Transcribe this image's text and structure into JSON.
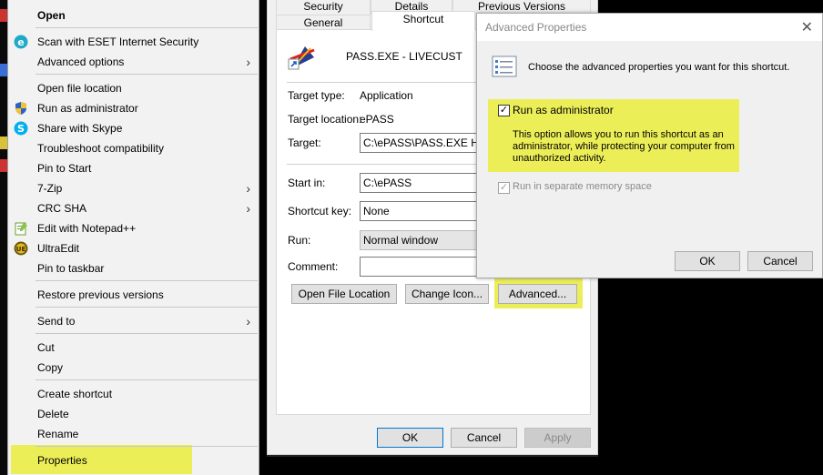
{
  "context_menu": {
    "open": "Open",
    "scan_eset": "Scan with ESET Internet Security",
    "advanced_options": "Advanced options",
    "open_file_location": "Open file location",
    "run_as_admin": "Run as administrator",
    "share_skype": "Share with Skype",
    "troubleshoot": "Troubleshoot compatibility",
    "pin_start": "Pin to Start",
    "seven_zip": "7-Zip",
    "crc_sha": "CRC SHA",
    "edit_notepadpp": "Edit with Notepad++",
    "ultraedit": "UltraEdit",
    "pin_taskbar": "Pin to taskbar",
    "restore_versions": "Restore previous versions",
    "send_to": "Send to",
    "cut": "Cut",
    "copy": "Copy",
    "create_shortcut": "Create shortcut",
    "delete": "Delete",
    "rename": "Rename",
    "properties": "Properties"
  },
  "properties_dialog": {
    "tabs": [
      "Security",
      "Details",
      "Previous Versions",
      "General",
      "Shortcut"
    ],
    "active_tab": "Shortcut",
    "shortcut_name": "PASS.EXE - LIVECUST",
    "target_type_label": "Target type:",
    "target_type_value": "Application",
    "target_location_label": "Target location:",
    "target_location_value": "ePASS",
    "target_label": "Target:",
    "target_value": "C:\\ePASS\\PASS.EXE HAI",
    "start_in_label": "Start in:",
    "start_in_value": "C:\\ePASS",
    "shortcut_key_label": "Shortcut key:",
    "shortcut_key_value": "None",
    "run_label": "Run:",
    "run_value": "Normal window",
    "comment_label": "Comment:",
    "comment_value": "",
    "open_file_location_btn": "Open File Location",
    "change_icon_btn": "Change Icon...",
    "advanced_btn": "Advanced...",
    "ok_btn": "OK",
    "cancel_btn": "Cancel",
    "apply_btn": "Apply"
  },
  "advanced_dialog": {
    "title": "Advanced Properties",
    "close_glyph": "✕",
    "description": "Choose the advanced properties you want for this shortcut.",
    "run_as_admin_label": "Run as administrator",
    "run_as_admin_checked": true,
    "run_as_admin_help": "This option allows you to run this shortcut as an administrator, while protecting your computer from unauthorized activity.",
    "separate_memory_label": "Run in separate memory space",
    "separate_memory_checked": true,
    "separate_memory_disabled": true,
    "ok_btn": "OK",
    "cancel_btn": "Cancel"
  },
  "colors": {
    "highlight": "#ecee58",
    "menu_bg": "#f2f2f2",
    "dialog_bg": "#f0f0f0",
    "accent": "#0078d7"
  },
  "icons": {
    "eset": "eset-icon",
    "shield": "uac-shield-icon",
    "skype": "skype-icon",
    "notepadpp": "notepad-plus-plus-icon",
    "ultraedit": "ultraedit-icon",
    "submenu": "chevron-right-icon"
  }
}
